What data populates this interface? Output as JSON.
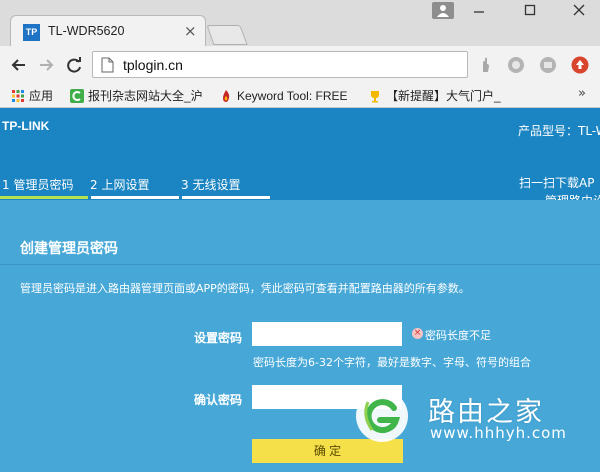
{
  "browser": {
    "tab_title": "TL-WDR5620",
    "tab_favicon_text": "TP",
    "url": "tplogin.cn",
    "bookmarks": [
      {
        "label": "应用",
        "icon": "apps-grid-icon"
      },
      {
        "label": "报刊杂志网站大全_沪",
        "icon": "c-logo-icon"
      },
      {
        "label": "Keyword Tool: FREE",
        "icon": "flame-icon"
      },
      {
        "label": "【新提醒】大气门户_",
        "icon": "trophy-icon"
      }
    ],
    "bookmarks_more": "»"
  },
  "router": {
    "brand": "TP-LINK",
    "model_label": "产品型号：TL-W",
    "steps": [
      {
        "label": "1 管理员密码",
        "active": true
      },
      {
        "label": "2 上网设置",
        "active": false
      },
      {
        "label": "3 无线设置",
        "active": false
      }
    ],
    "scan_line1": "扫一扫下载AP",
    "scan_line2": "管理路由设"
  },
  "form": {
    "title": "创建管理员密码",
    "description": "管理员密码是进入路由器管理页面或APP的密码，凭此密码可查看并配置路由器的所有参数。",
    "password_label": "设置密码",
    "password_value": "",
    "error_text": "密码长度不足",
    "hint": "密码长度为6-32个字符，最好是数字、字母、符号的组合",
    "confirm_label": "确认密码",
    "confirm_value": "",
    "submit_label": "确 定"
  },
  "watermark": {
    "name": "路由之家",
    "url": "www.hhhyh.com"
  },
  "colors": {
    "header_bg": "#1b84c2",
    "main_bg": "#47a8d8",
    "active_step": "#b7e14d",
    "button_bg": "#f6e04a"
  }
}
